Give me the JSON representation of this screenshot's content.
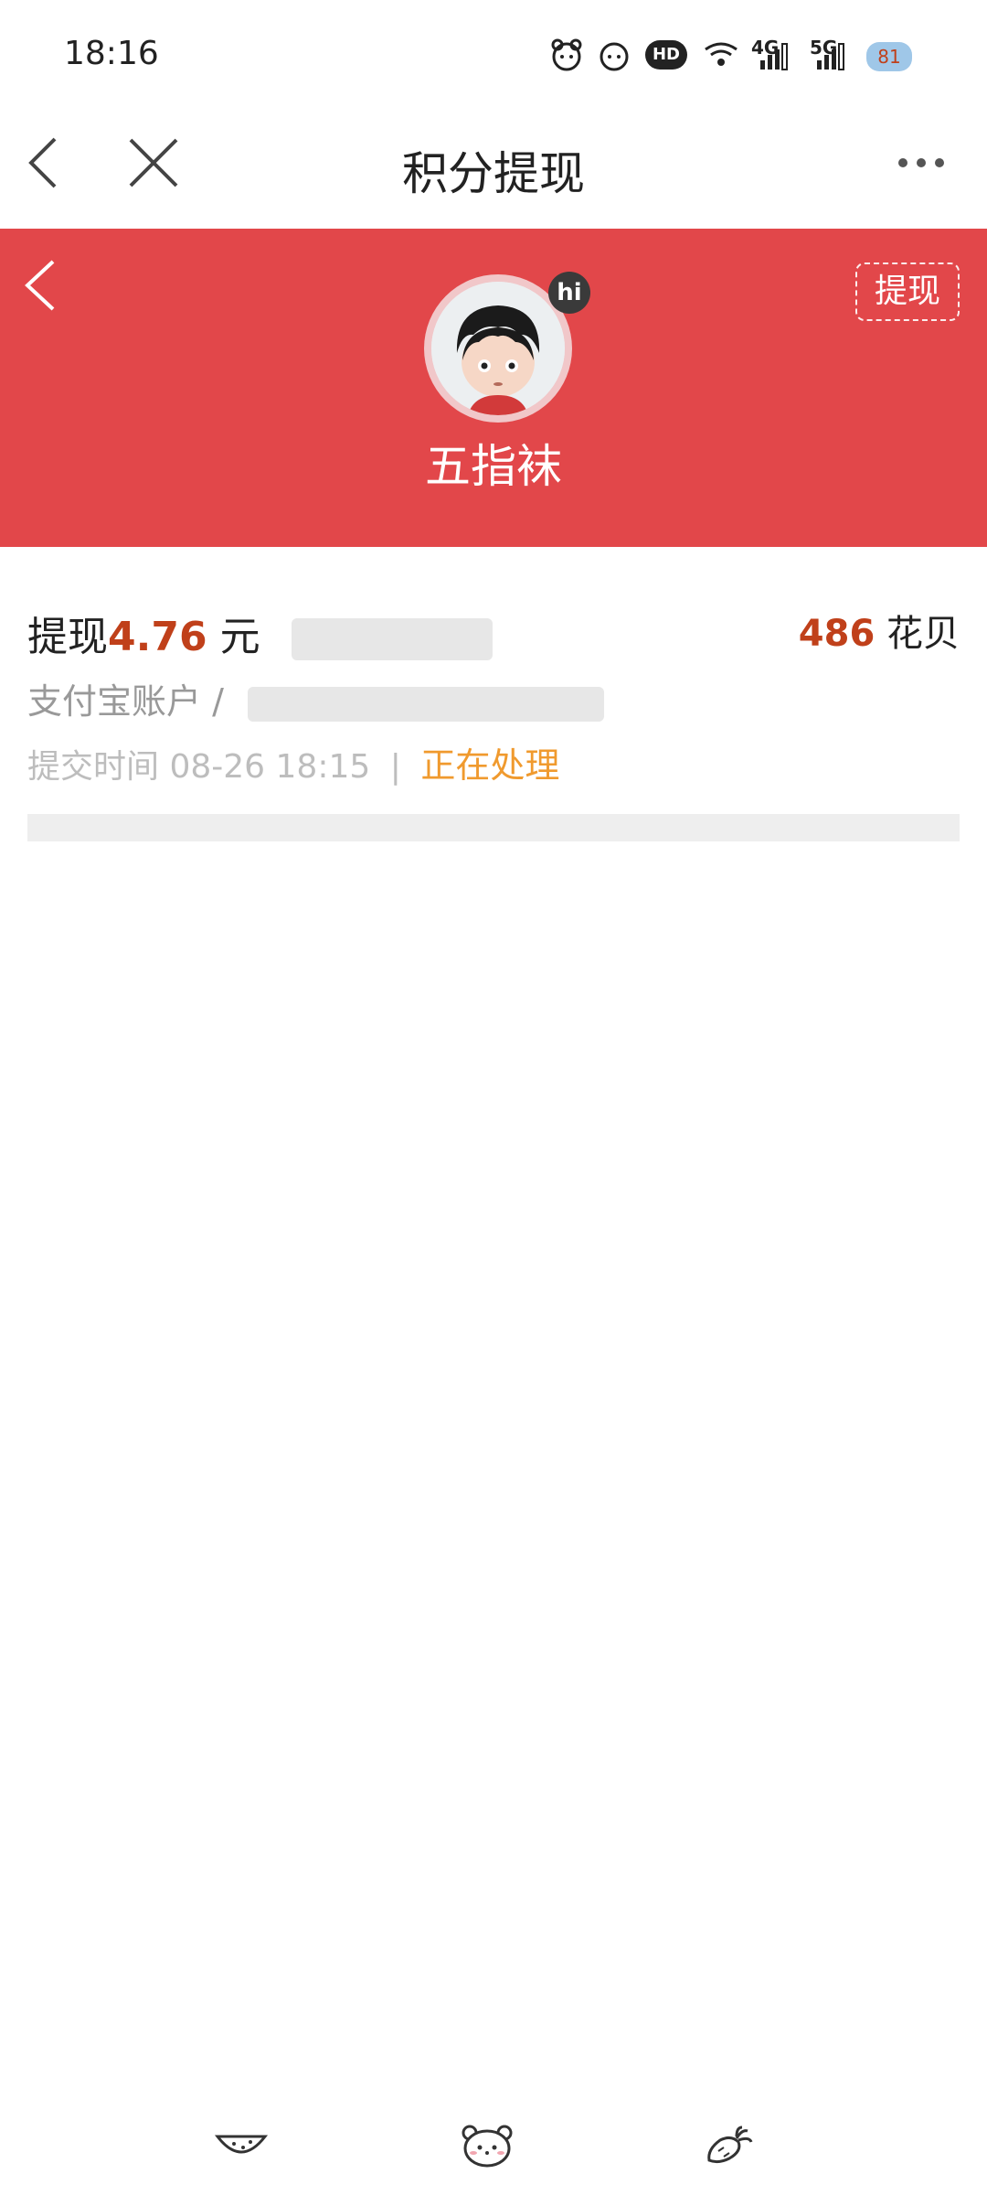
{
  "status_bar": {
    "time": "18:16",
    "battery": "81",
    "network_1": "4G",
    "network_2": "5G",
    "hd": "HD"
  },
  "nav": {
    "title": "积分提现",
    "back_icon": "chevron-left-icon",
    "close_icon": "close-icon",
    "more_icon": "more-horizontal-icon"
  },
  "profile": {
    "username": "五指袜",
    "badge": "hi",
    "withdraw_button": "提现",
    "banner_color": "#e2474a"
  },
  "record": {
    "label": "提现",
    "amount": "4.76",
    "unit": "元",
    "points_value": "486",
    "points_unit": "花贝",
    "account_label": "支付宝账户 /",
    "submit_label": "提交时间",
    "submit_time": "08-26 18:15",
    "separator": "|",
    "status": "正在处理",
    "accent_color": "#c0401a",
    "status_color": "#f09a2e"
  },
  "bottom_nav": {
    "icons": [
      "watermelon-icon",
      "bear-face-icon",
      "carrot-icon"
    ]
  }
}
